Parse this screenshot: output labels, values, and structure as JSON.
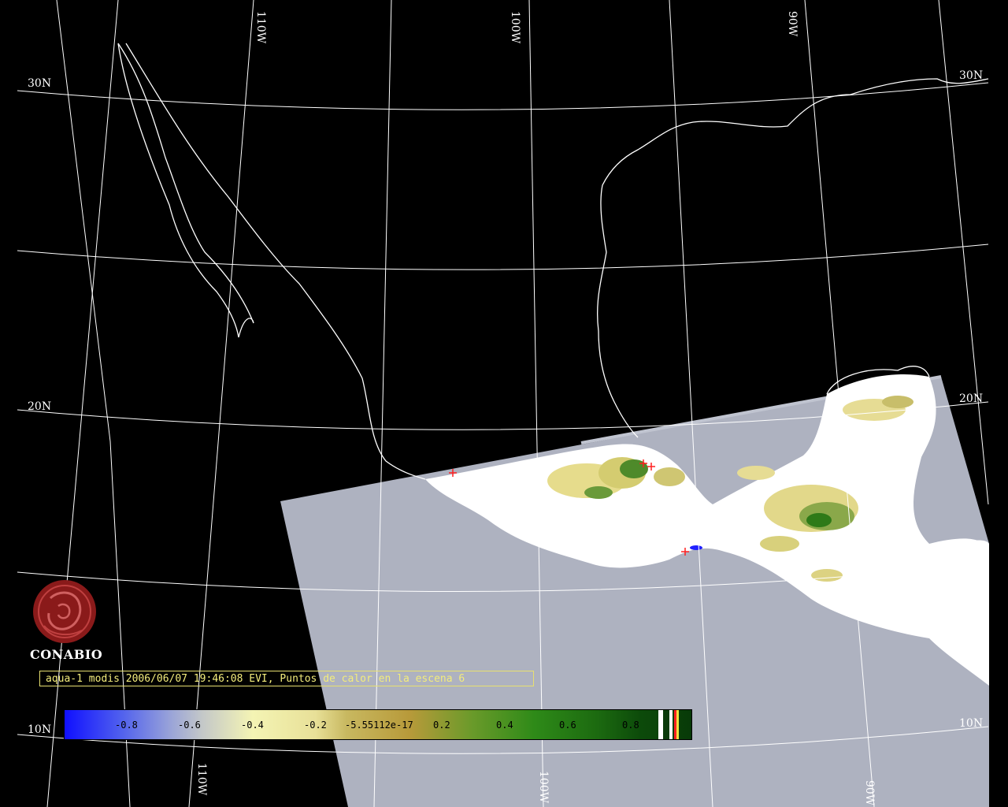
{
  "graticule": {
    "lat_labels": [
      "30N",
      "20N",
      "10N"
    ],
    "lon_labels": [
      "110W",
      "100W",
      "90W"
    ]
  },
  "logo": {
    "name": "CONABIO"
  },
  "caption": "aqua-1 modis 2006/06/07 19:46:08 EVI, Puntos de calor en la escena 6",
  "colorbar": {
    "labels": [
      "-0.8",
      "-0.6",
      "-0.4",
      "-0.2",
      "-5.55112e-17",
      "0.2",
      "0.4",
      "0.6",
      "0.8"
    ]
  },
  "colors": {
    "background": "#000000",
    "no_data": "#aeb2c0",
    "vegetation_low": "#e8e08c",
    "vegetation_high": "#2e7a18",
    "hotspot": "#ff2020",
    "water": "#2020ff",
    "coastline": "#ffffff",
    "caption_text": "#f3ec7c",
    "logo": "#8a1a1a"
  }
}
